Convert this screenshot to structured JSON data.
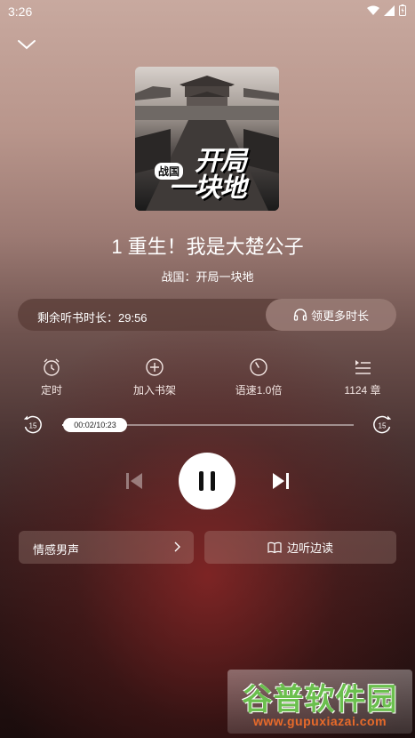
{
  "status_bar": {
    "time": "3:26"
  },
  "cover": {
    "badge": "战国",
    "title_line1": "开局",
    "title_line2": "一块地"
  },
  "chapter_title": "1 重生！我是大楚公子",
  "book_name": "战国：开局一块地",
  "remaining": {
    "label": "剩余听书时长：29:56",
    "button": "领更多时长"
  },
  "functions": [
    {
      "label": "定时",
      "icon": "alarm-clock-icon"
    },
    {
      "label": "加入书架",
      "icon": "plus-circle-icon"
    },
    {
      "label": "语速1.0倍",
      "icon": "speedometer-icon"
    },
    {
      "label": "1124 章",
      "icon": "chapter-list-icon"
    }
  ],
  "progress": {
    "current": "00:02",
    "total": "10:23",
    "display": "00:02/10:23",
    "fraction": 0.003,
    "skip_seconds": "15"
  },
  "voice": {
    "label": "情感男声"
  },
  "read_along": {
    "label": "边听边读"
  },
  "watermark": {
    "text": "谷普软件园",
    "url": "www.gupuxiazai.com"
  },
  "colors": {
    "accent": "#ffffff",
    "bar_bg": "#5a3c37",
    "watermark_green": "#6bbf4e",
    "watermark_orange": "#e86a2a"
  }
}
